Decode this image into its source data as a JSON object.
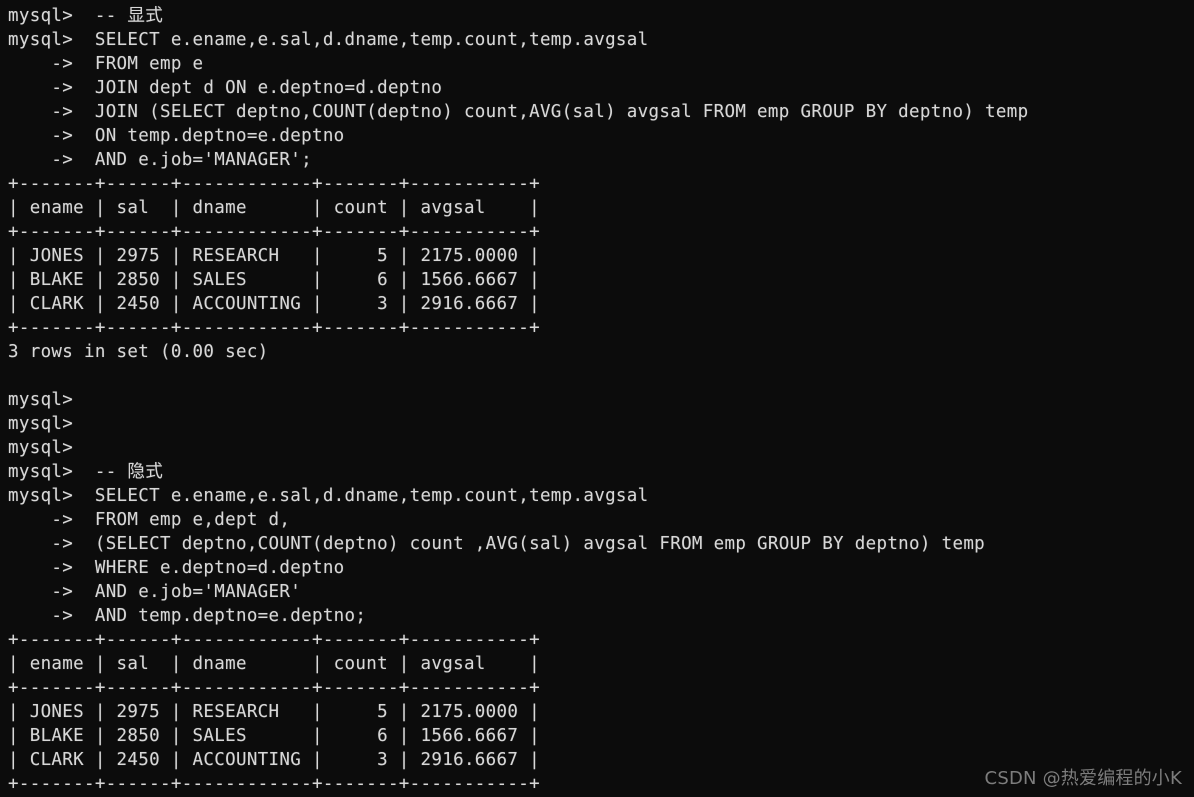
{
  "terminal": {
    "background_color": "#0c0c0c",
    "text_color": "#d8d8d8",
    "prompt": "mysql> ",
    "continuation_prompt": "    -> ",
    "lines": [
      "mysql>  -- 显式",
      "mysql>  SELECT e.ename,e.sal,d.dname,temp.count,temp.avgsal",
      "    ->  FROM emp e",
      "    ->  JOIN dept d ON e.deptno=d.deptno",
      "    ->  JOIN (SELECT deptno,COUNT(deptno) count,AVG(sal) avgsal FROM emp GROUP BY deptno) temp",
      "    ->  ON temp.deptno=e.deptno",
      "    ->  AND e.job='MANAGER';",
      "+-------+------+------------+-------+-----------+",
      "| ename | sal  | dname      | count | avgsal    |",
      "+-------+------+------------+-------+-----------+",
      "| JONES | 2975 | RESEARCH   |     5 | 2175.0000 |",
      "| BLAKE | 2850 | SALES      |     6 | 1566.6667 |",
      "| CLARK | 2450 | ACCOUNTING |     3 | 2916.6667 |",
      "+-------+------+------------+-------+-----------+",
      "3 rows in set (0.00 sec)",
      "",
      "mysql>",
      "mysql>",
      "mysql>",
      "mysql>  -- 隐式",
      "mysql>  SELECT e.ename,e.sal,d.dname,temp.count,temp.avgsal",
      "    ->  FROM emp e,dept d,",
      "    ->  (SELECT deptno,COUNT(deptno) count ,AVG(sal) avgsal FROM emp GROUP BY deptno) temp",
      "    ->  WHERE e.deptno=d.deptno",
      "    ->  AND e.job='MANAGER'",
      "    ->  AND temp.deptno=e.deptno;",
      "+-------+------+------------+-------+-----------+",
      "| ename | sal  | dname      | count | avgsal    |",
      "+-------+------+------------+-------+-----------+",
      "| JONES | 2975 | RESEARCH   |     5 | 2175.0000 |",
      "| BLAKE | 2850 | SALES      |     6 | 1566.6667 |",
      "| CLARK | 2450 | ACCOUNTING |     3 | 2916.6667 |",
      "+-------+------+------------+-------+-----------+"
    ],
    "queries": [
      {
        "comment": "-- 显式",
        "comment_meaning": "explicit",
        "sql": [
          "SELECT e.ename,e.sal,d.dname,temp.count,temp.avgsal",
          "FROM emp e",
          "JOIN dept d ON e.deptno=d.deptno",
          "JOIN (SELECT deptno,COUNT(deptno) count,AVG(sal) avgsal FROM emp GROUP BY deptno) temp",
          "ON temp.deptno=e.deptno",
          "AND e.job='MANAGER';"
        ],
        "status": "3 rows in set (0.00 sec)"
      },
      {
        "comment": "-- 隐式",
        "comment_meaning": "implicit",
        "sql": [
          "SELECT e.ename,e.sal,d.dname,temp.count,temp.avgsal",
          "FROM emp e,dept d,",
          "(SELECT deptno,COUNT(deptno) count ,AVG(sal) avgsal FROM emp GROUP BY deptno) temp",
          "WHERE e.deptno=d.deptno",
          "AND e.job='MANAGER'",
          "AND temp.deptno=e.deptno;"
        ],
        "status": ""
      }
    ],
    "result_table": {
      "columns": [
        "ename",
        "sal",
        "dname",
        "count",
        "avgsal"
      ],
      "rows": [
        [
          "JONES",
          "2975",
          "RESEARCH",
          "5",
          "2175.0000"
        ],
        [
          "BLAKE",
          "2850",
          "SALES",
          "6",
          "1566.6667"
        ],
        [
          "CLARK",
          "2450",
          "ACCOUNTING",
          "3",
          "2916.6667"
        ]
      ]
    }
  },
  "watermark": {
    "text": "CSDN @热爱编程的小K",
    "color": "#7d7d7d"
  }
}
